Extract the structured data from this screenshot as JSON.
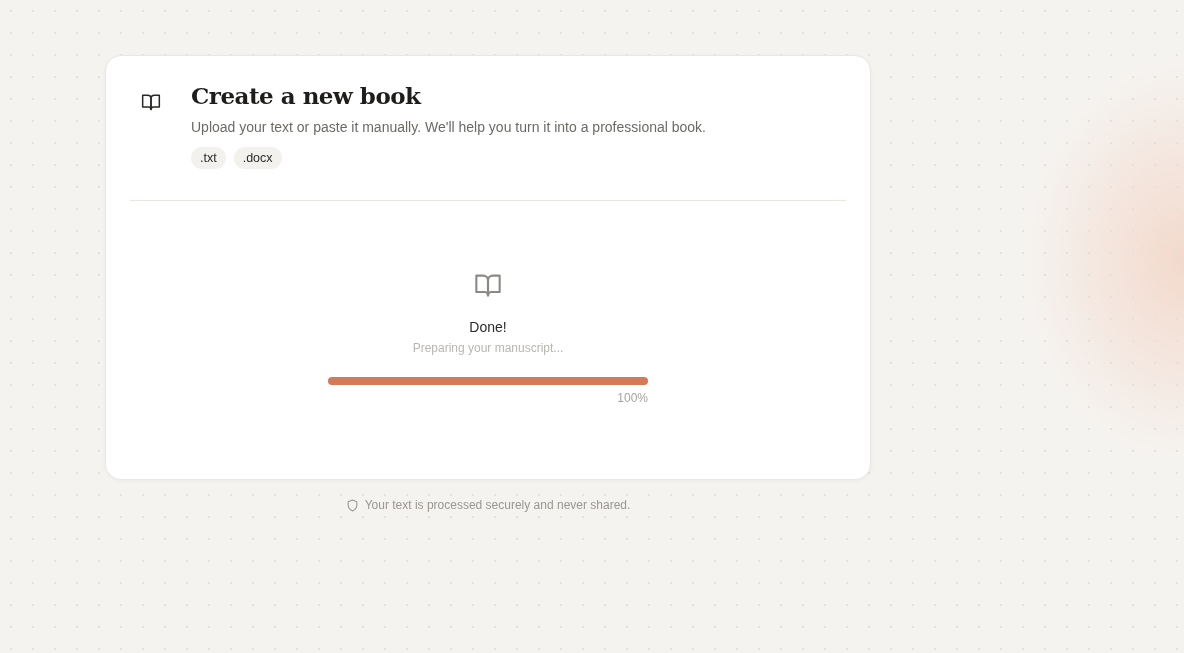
{
  "header": {
    "title": "Create a new book",
    "subtitle": "Upload your text or paste it manually. We'll help you turn it into a professional book.",
    "formats": [
      ".txt",
      ".docx"
    ]
  },
  "progress": {
    "status": "Done!",
    "message": "Preparing your manuscript...",
    "level": 1.0,
    "percent": "100%"
  },
  "footer": {
    "note": "Your text is processed securely and never shared."
  }
}
